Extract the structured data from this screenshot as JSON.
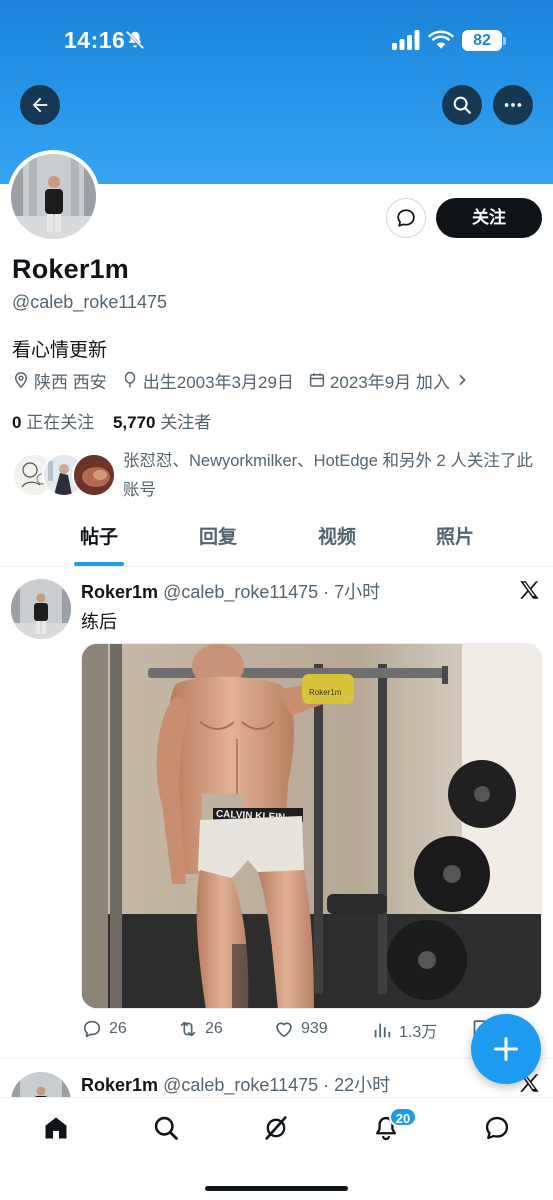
{
  "status_bar": {
    "time": "14:16",
    "battery": "82"
  },
  "profile": {
    "display_name": "Roker1m",
    "handle": "@caleb_roke11475",
    "bio": "看心情更新",
    "location": "陕西 西安",
    "birth": "出生2003年3月29日",
    "joined": "2023年9月 加入",
    "following_count": "0",
    "following_label": "正在关注",
    "followers_count": "5,770",
    "followers_label": "关注者",
    "followed_by_text": "张怼怼、Newyorkmilker、HotEdge 和另外 2 人关注了此账号",
    "follow_button": "关注"
  },
  "tabs": [
    "帖子",
    "回复",
    "视频",
    "照片"
  ],
  "active_tab": "帖子",
  "posts": [
    {
      "name": "Roker1m",
      "meta": "@caleb_roke11475 · 7小时",
      "text": "练后",
      "media_phone_case_text": "Roker1m",
      "media_waistband_text": "CALVIN KLEIN",
      "replies": "26",
      "reposts": "26",
      "likes": "939",
      "views": "1.3万"
    },
    {
      "name": "Roker1m",
      "meta": "@caleb_roke11475 · 22小时"
    }
  ],
  "bottom_nav": {
    "items": [
      "home-icon",
      "search-icon",
      "grok-icon",
      "bell-icon",
      "messages-icon"
    ],
    "notifications_badge": "20"
  },
  "colors": {
    "accent": "#1d9bf0",
    "text_primary": "#0f1419",
    "text_secondary": "#536471",
    "banner": "#2a97ea"
  }
}
